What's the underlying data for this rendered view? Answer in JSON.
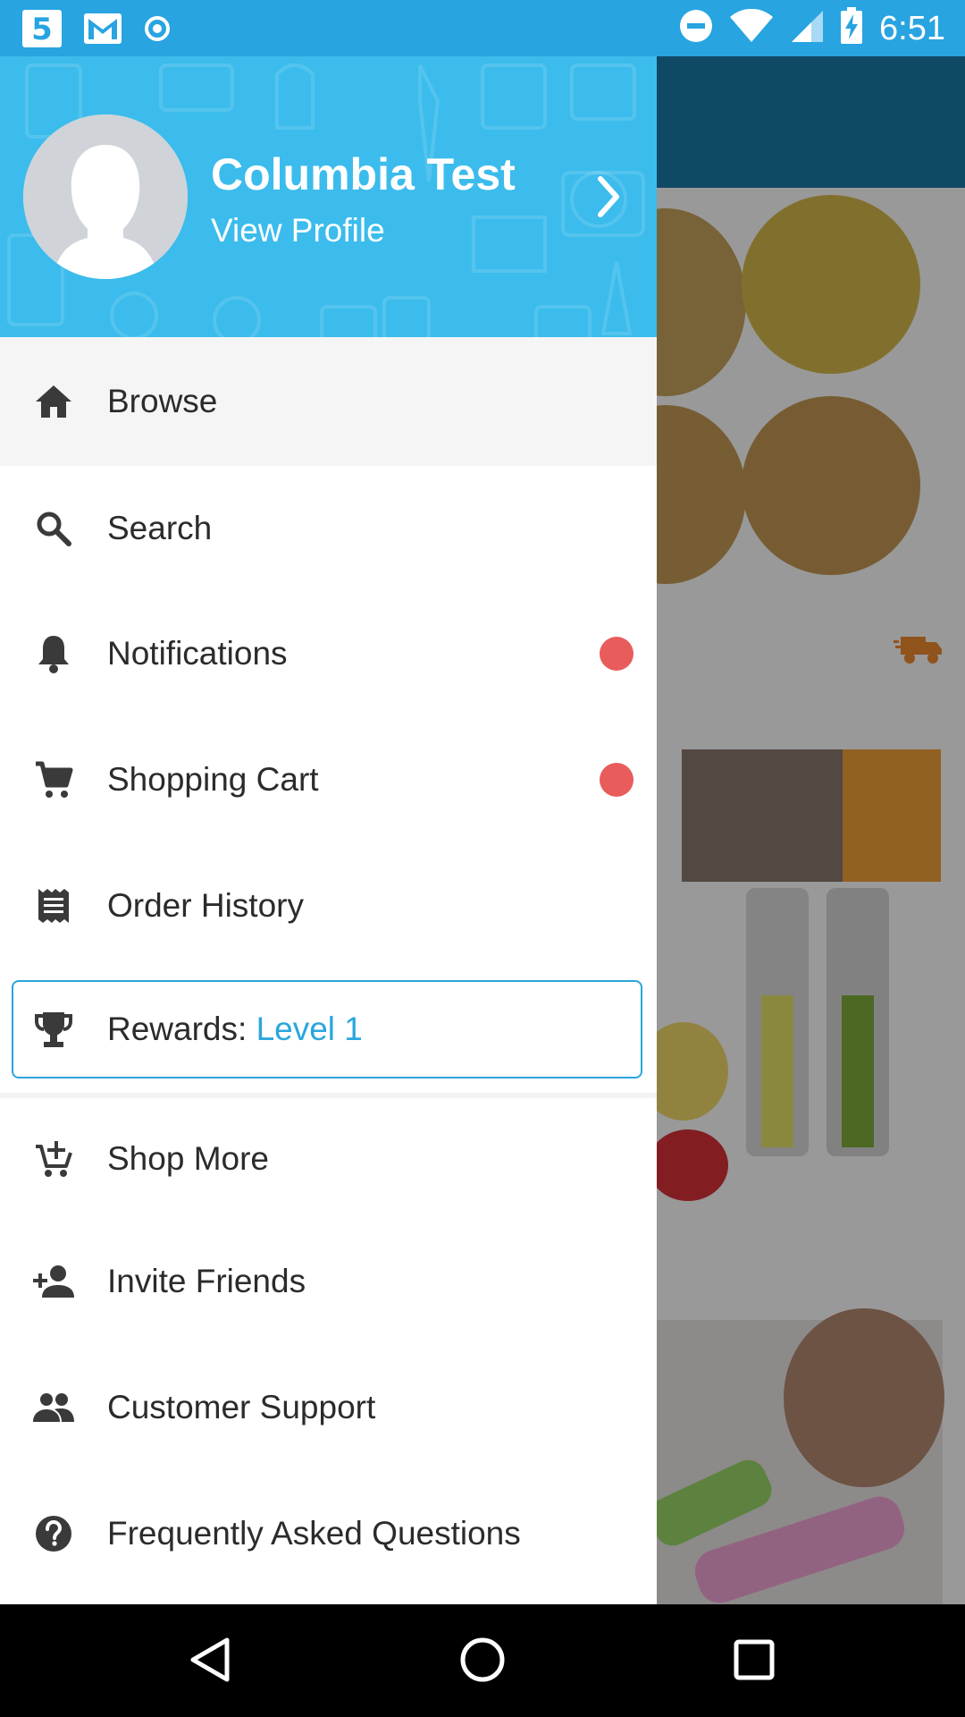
{
  "status_bar": {
    "time": "6:51",
    "left_icons": [
      "app-5-icon",
      "gmail-icon",
      "record-icon"
    ],
    "right_icons": [
      "do-not-disturb-icon",
      "wifi-icon",
      "signal-icon",
      "battery-charging-icon"
    ]
  },
  "drawer": {
    "profile": {
      "name": "Columbia Test",
      "link": "View Profile"
    },
    "items": [
      {
        "label": "Browse",
        "icon": "home-icon"
      },
      {
        "label": "Search",
        "icon": "search-icon"
      },
      {
        "label": "Notifications",
        "icon": "bell-icon",
        "badge": true
      },
      {
        "label": "Shopping Cart",
        "icon": "cart-icon",
        "badge": true
      },
      {
        "label": "Order History",
        "icon": "receipt-icon"
      },
      {
        "label": "Rewards: ",
        "level": "Level 1",
        "icon": "trophy-icon"
      },
      {
        "label": "Shop More",
        "icon": "cart-plus-icon"
      },
      {
        "label": "Invite Friends",
        "icon": "person-add-icon"
      },
      {
        "label": "Customer Support",
        "icon": "people-icon"
      },
      {
        "label": "Frequently Asked Questions",
        "icon": "help-icon"
      }
    ]
  },
  "colors": {
    "status_bar": "#28a4e1",
    "header": "#3bbcec",
    "accent": "#2aa6dd",
    "badge": "#e85c5c",
    "toolbar_behind": "#1a7aa8"
  },
  "nav_bar": {
    "buttons": [
      "back-icon",
      "home-circle-icon",
      "recents-icon"
    ]
  }
}
